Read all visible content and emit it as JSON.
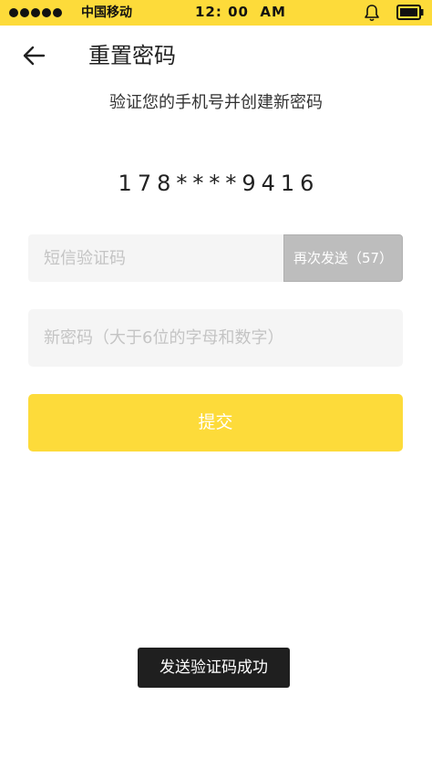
{
  "status_bar": {
    "carrier": "中国移动",
    "time": "12: 00  AM",
    "signal_icon": "signal-dots-icon",
    "notification_icon": "bell-icon",
    "battery_icon": "battery-icon",
    "accent_color": "#fddb3a"
  },
  "header": {
    "back_icon": "arrow-left-icon",
    "title": "重置密码"
  },
  "subtitle": "验证您的手机号并创建新密码",
  "phone_number": "178****9416",
  "form": {
    "sms_code_placeholder": "短信验证码",
    "resend_label": "再次发送（57）",
    "new_password_placeholder": "新密码（大于6位的字母和数字）",
    "submit_label": "提交"
  },
  "toast": "发送验证码成功"
}
